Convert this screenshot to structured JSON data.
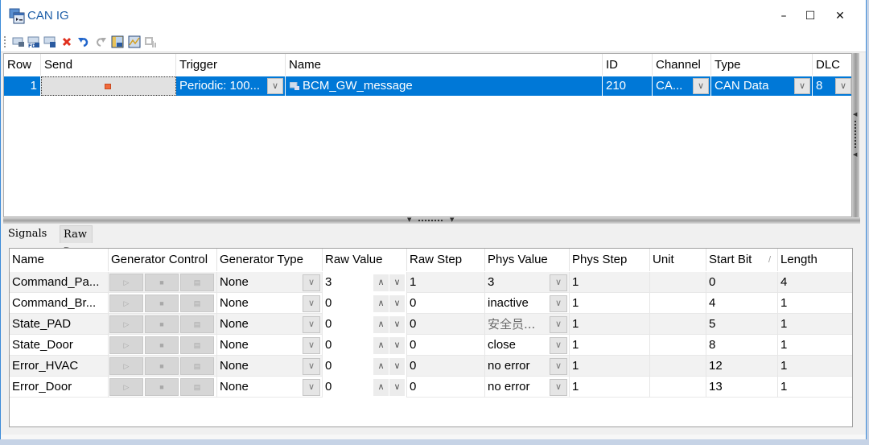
{
  "window": {
    "title": "CAN IG",
    "controls": {
      "minimize": "–",
      "maximize": "☐",
      "close": "✕"
    }
  },
  "toolbar": {
    "icons": [
      "add-message-icon",
      "add-fd-message-icon",
      "add-id-message-icon",
      "delete-icon",
      "undo-icon",
      "redo-icon",
      "signal-view-icon",
      "graph-view-icon",
      "settings-disabled-icon"
    ]
  },
  "message_table": {
    "headers": {
      "row": "Row",
      "send": "Send",
      "trigger": "Trigger",
      "name": "Name",
      "id": "ID",
      "channel": "Channel",
      "type": "Type",
      "dlc": "DLC"
    },
    "rows": [
      {
        "row": "1",
        "send_icon": "stop-icon",
        "trigger": "Periodic: 100...",
        "name": "BCM_GW_message",
        "id": "210",
        "channel": "CA...",
        "type": "CAN Data",
        "dlc": "8"
      }
    ]
  },
  "tabs": [
    {
      "label": "Signals",
      "active": true
    },
    {
      "label": "Raw Data",
      "active": false
    }
  ],
  "signal_table": {
    "headers": {
      "name": "Name",
      "gen_control": "Generator Control",
      "gen_type": "Generator Type",
      "raw_value": "Raw Value",
      "raw_step": "Raw Step",
      "phys_value": "Phys Value",
      "phys_step": "Phys Step",
      "unit": "Unit",
      "start_bit": "Start Bit",
      "length": "Length"
    },
    "sort_indicator": "/",
    "rows": [
      {
        "name": "Command_Pa...",
        "gen_type": "None",
        "raw_value": "3",
        "raw_step": "1",
        "phys_value": "3",
        "phys_step": "1",
        "unit": "",
        "start_bit": "0",
        "length": "4"
      },
      {
        "name": "Command_Br...",
        "gen_type": "None",
        "raw_value": "0",
        "raw_step": "0",
        "phys_value": "inactive",
        "phys_step": "1",
        "unit": "",
        "start_bit": "4",
        "length": "1"
      },
      {
        "name": "State_PAD",
        "gen_type": "None",
        "raw_value": "0",
        "raw_step": "0",
        "phys_value": "安全员...",
        "phys_step": "1",
        "unit": "",
        "start_bit": "5",
        "length": "1"
      },
      {
        "name": "State_Door",
        "gen_type": "None",
        "raw_value": "0",
        "raw_step": "0",
        "phys_value": "close",
        "phys_step": "1",
        "unit": "",
        "start_bit": "8",
        "length": "1"
      },
      {
        "name": "Error_HVAC",
        "gen_type": "None",
        "raw_value": "0",
        "raw_step": "0",
        "phys_value": "no error",
        "phys_step": "1",
        "unit": "",
        "start_bit": "12",
        "length": "1"
      },
      {
        "name": "Error_Door",
        "gen_type": "None",
        "raw_value": "0",
        "raw_step": "0",
        "phys_value": "no error",
        "phys_step": "1",
        "unit": "",
        "start_bit": "13",
        "length": "1"
      }
    ]
  },
  "colors": {
    "selection": "#0078d7",
    "title_text": "#1f5fa8",
    "send_stop": "#f06a3c"
  }
}
